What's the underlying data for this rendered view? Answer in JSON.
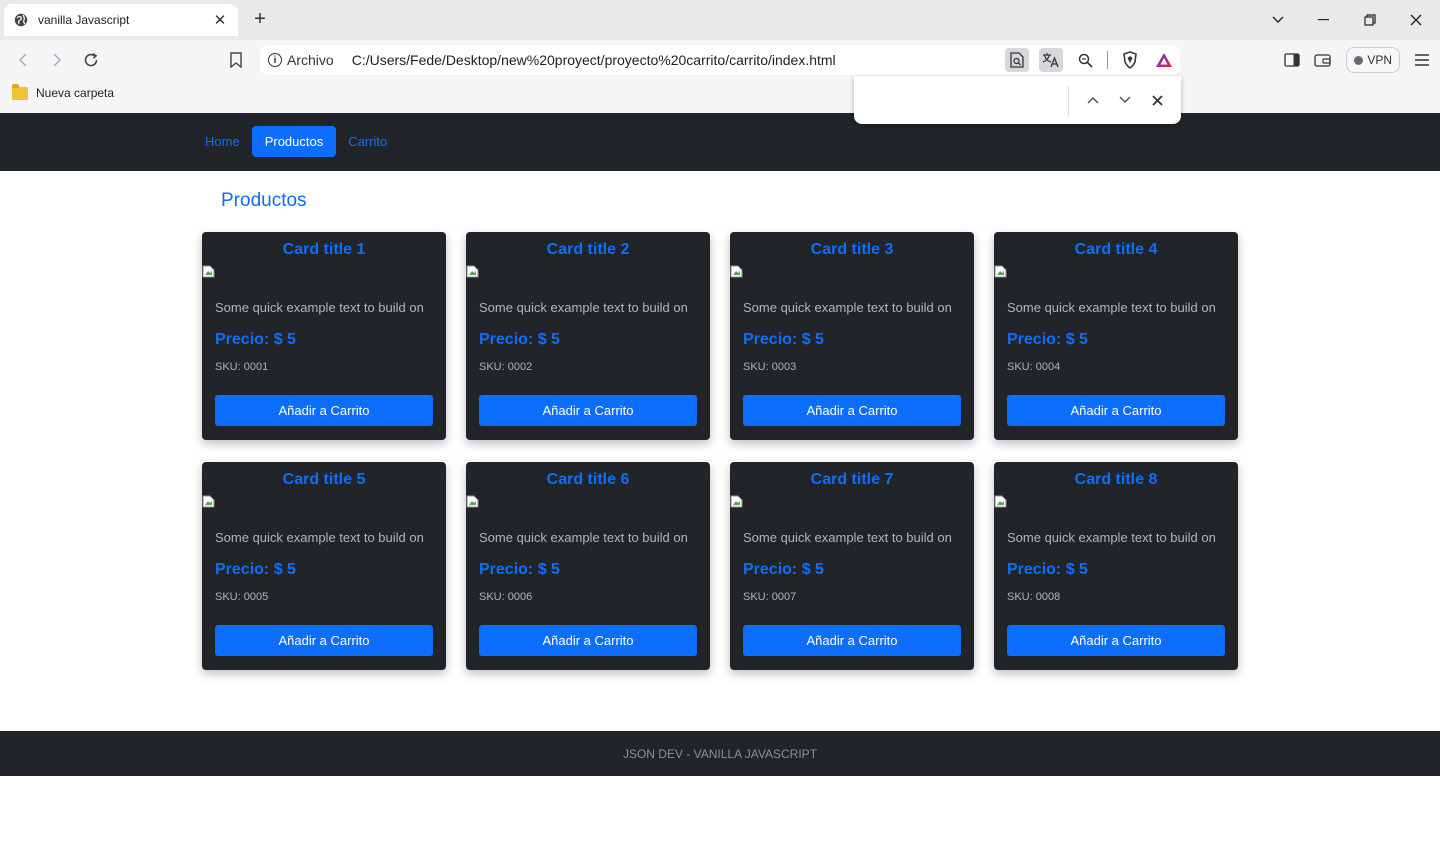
{
  "browser": {
    "tab_title": "vanilla Javascript",
    "tab_close": "✕",
    "new_tab": "+",
    "scheme_label": "Archivo",
    "url": "C:/Users/Fede/Desktop/new%20proyect/proyecto%20carrito/carrito/index.html",
    "vpn_label": "VPN",
    "bookmark_folder": "Nueva carpeta",
    "find_query": ""
  },
  "navbar": {
    "links": [
      {
        "label": "Home"
      },
      {
        "label": "Productos",
        "active": true
      },
      {
        "label": "Carrito"
      }
    ]
  },
  "page": {
    "section_title": "Productos"
  },
  "cards": [
    {
      "title": "Card title 1",
      "text": "Some quick example text to build on",
      "price": "Precio: $ 5",
      "sku": "SKU: 0001",
      "button": "Añadir a Carrito"
    },
    {
      "title": "Card title 2",
      "text": "Some quick example text to build on",
      "price": "Precio: $ 5",
      "sku": "SKU: 0002",
      "button": "Añadir a Carrito"
    },
    {
      "title": "Card title 3",
      "text": "Some quick example text to build on",
      "price": "Precio: $ 5",
      "sku": "SKU: 0003",
      "button": "Añadir a Carrito"
    },
    {
      "title": "Card title 4",
      "text": "Some quick example text to build on",
      "price": "Precio: $ 5",
      "sku": "SKU: 0004",
      "button": "Añadir a Carrito"
    },
    {
      "title": "Card title 5",
      "text": "Some quick example text to build on",
      "price": "Precio: $ 5",
      "sku": "SKU: 0005",
      "button": "Añadir a Carrito"
    },
    {
      "title": "Card title 6",
      "text": "Some quick example text to build on",
      "price": "Precio: $ 5",
      "sku": "SKU: 0006",
      "button": "Añadir a Carrito"
    },
    {
      "title": "Card title 7",
      "text": "Some quick example text to build on",
      "price": "Precio: $ 5",
      "sku": "SKU: 0007",
      "button": "Añadir a Carrito"
    },
    {
      "title": "Card title 8",
      "text": "Some quick example text to build on",
      "price": "Precio: $ 5",
      "sku": "SKU: 0008",
      "button": "Añadir a Carrito"
    }
  ],
  "footer": {
    "text": "JSON DEV - VANILLA JAVASCRIPT"
  },
  "colors": {
    "accent": "#0d6efd",
    "dark": "#212529",
    "muted_text": "#adb5bd"
  },
  "icons": [
    "globe-icon",
    "close-icon",
    "plus-icon",
    "back-icon",
    "forward-icon",
    "reload-icon",
    "bookmark-icon",
    "info-icon",
    "reader-mode-icon",
    "translate-icon",
    "zoom-icon",
    "brave-shield-icon",
    "brave-rewards-icon",
    "sidebar-icon",
    "wallet-icon",
    "menu-icon",
    "folder-icon",
    "broken-image-icon",
    "chevron-up-icon",
    "chevron-down-icon"
  ]
}
